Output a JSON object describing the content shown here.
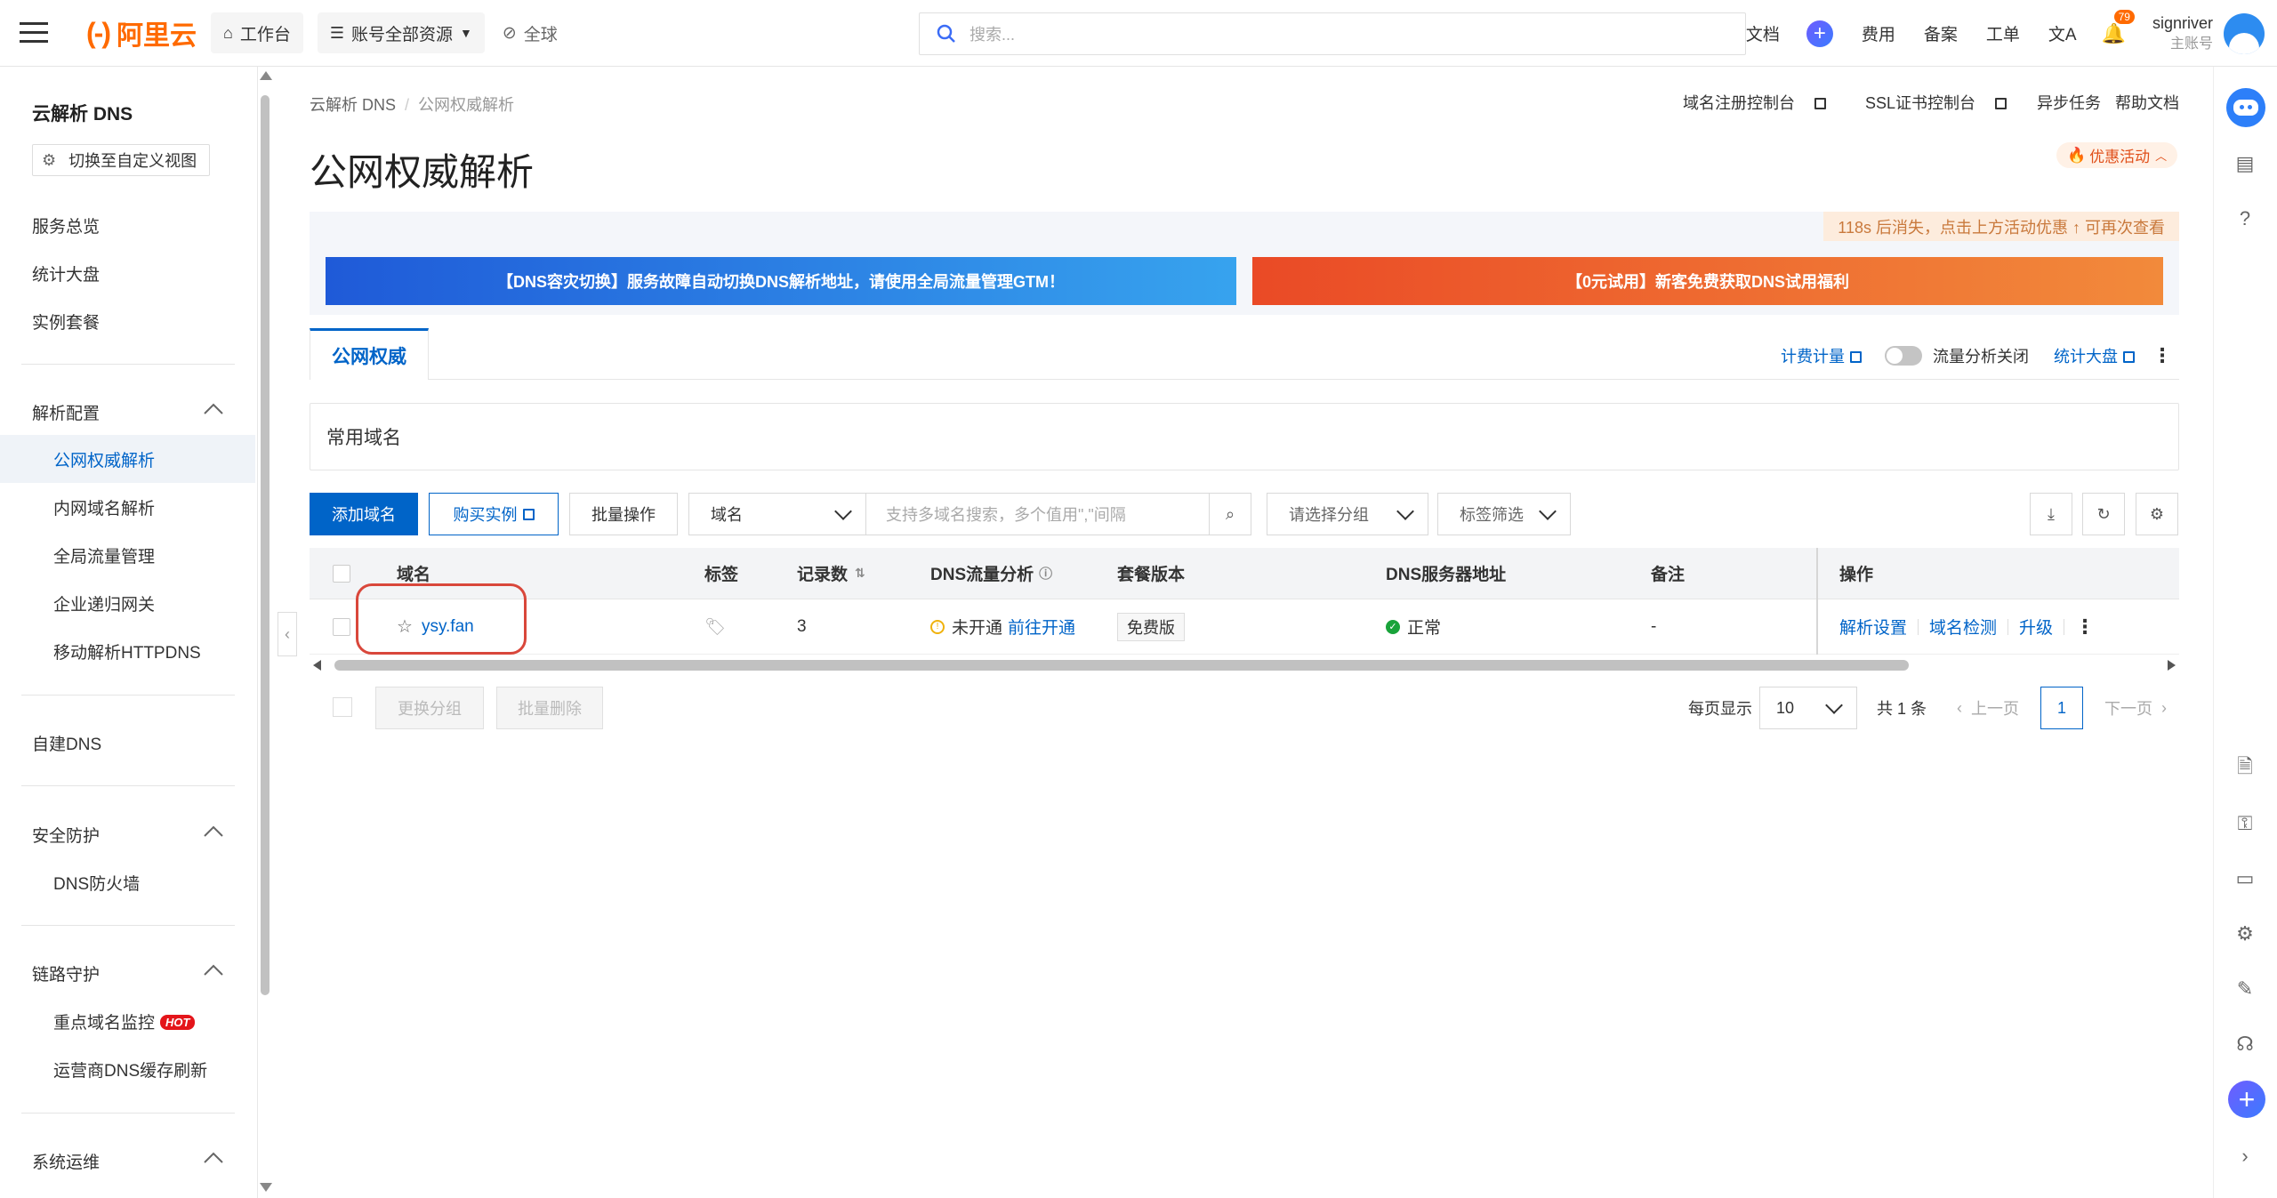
{
  "topbar": {
    "logo_text": "阿里云",
    "workbench": "工作台",
    "resources": "账号全部资源",
    "region": "全球",
    "search_placeholder": "搜索...",
    "links": [
      "文档",
      "费用",
      "备案",
      "工单"
    ],
    "notification_count": "79",
    "user_name": "signriver",
    "user_role": "主账号"
  },
  "sidebar": {
    "title": "云解析 DNS",
    "switch_view": "切换至自定义视图",
    "items_top": [
      "服务总览",
      "统计大盘",
      "实例套餐"
    ],
    "group_resolve": "解析配置",
    "resolve_items": [
      "公网权威解析",
      "内网域名解析",
      "全局流量管理",
      "企业递归网关",
      "移动解析HTTPDNS"
    ],
    "self_dns": "自建DNS",
    "group_security": "安全防护",
    "security_items": [
      "DNS防火墙"
    ],
    "group_link": "链路守护",
    "link_items": [
      "重点域名监控",
      "运营商DNS缓存刷新"
    ],
    "hot_badge": "HOT",
    "group_ops": "系统运维"
  },
  "breadcrumb": [
    "云解析 DNS",
    "公网权威解析"
  ],
  "header_links": [
    "域名注册控制台",
    "SSL证书控制台",
    "异步任务",
    "帮助文档"
  ],
  "page_title": "公网权威解析",
  "promo_pill": "优惠活动",
  "countdown": "118s 后消失，点击上方活动优惠 ↑ 可再次查看",
  "banners": {
    "left": "【DNS容灾切换】服务故障自动切换DNS解析地址，请使用全局流量管理GTM！",
    "right": "【0元试用】新客免费获取DNS试用福利"
  },
  "tab": "公网权威",
  "tab_right": {
    "billing": "计费计量",
    "traffic_toggle": "流量分析关闭",
    "dashboard": "统计大盘"
  },
  "common_domains": "常用域名",
  "toolbar": {
    "add_domain": "添加域名",
    "buy_instance": "购买实例",
    "batch_ops": "批量操作",
    "field_select": "域名",
    "search_placeholder": "支持多域名搜索，多个值用\",\"间隔",
    "group_select": "请选择分组",
    "tag_filter": "标签筛选"
  },
  "table": {
    "headers": [
      "域名",
      "标签",
      "记录数",
      "DNS流量分析",
      "套餐版本",
      "DNS服务器地址",
      "备注",
      "操作"
    ],
    "rows": [
      {
        "domain": "ysy.fan",
        "records": "3",
        "traffic_status": "未开通",
        "traffic_link": "前往开通",
        "plan": "免费版",
        "dns_status": "正常",
        "remark": "-",
        "ops": [
          "解析设置",
          "域名检测",
          "升级"
        ]
      }
    ]
  },
  "footer": {
    "change_group": "更换分组",
    "batch_delete": "批量删除",
    "per_page_label": "每页显示",
    "per_page": "10",
    "total": "共 1 条",
    "prev": "上一页",
    "page": "1",
    "next": "下一页"
  },
  "colors": {
    "brand_orange": "#ff6a00",
    "primary_blue": "#0064c8",
    "annotation_red": "#d9473b"
  }
}
